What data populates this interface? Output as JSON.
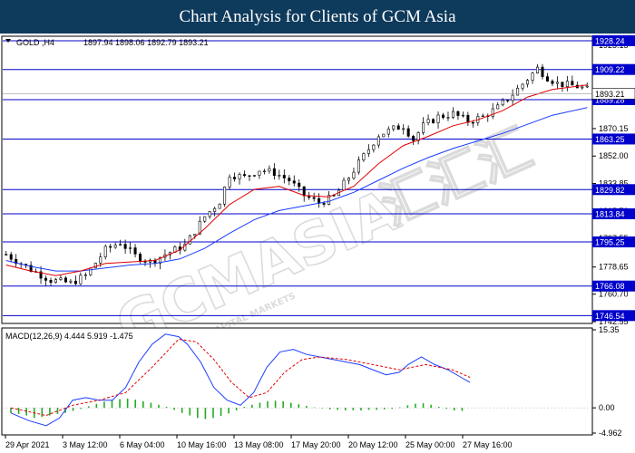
{
  "header": {
    "title": "Chart Analysis for Clients of GCM Asia"
  },
  "watermark": {
    "brand": "GCMASIA",
    "chinese": "汇汇汇",
    "sub": "GLOBAL CAPITAL MARKETS"
  },
  "chart_data": [
    {
      "type": "candlestick",
      "symbol_label": "GOLD ,H4",
      "ohlc_text": "1897.94 1898.06 1892.79 1893.21",
      "ylim": [
        1742.55,
        1930
      ],
      "y_ticks": [
        1925.15,
        1907.7,
        1889.25,
        1870.15,
        1852.0,
        1833.85,
        1815.7,
        1797.55,
        1778.65,
        1760.7,
        1742.55
      ],
      "y_tick_labels": [
        "1925.15",
        "1907.70",
        "1889.25",
        "1870.15",
        "1852.00",
        "1833.85",
        "1815.70",
        "1797.55",
        "1778.65",
        "1760.70",
        "1742.55"
      ],
      "current_price": 1893.21,
      "current_price_label": "1893.21",
      "levels": [
        {
          "value": 1928.24,
          "label": "1928.24"
        },
        {
          "value": 1909.22,
          "label": "1909.22"
        },
        {
          "value": 1889.28,
          "label": "1889.28"
        },
        {
          "value": 1863.25,
          "label": "1863.25"
        },
        {
          "value": 1829.82,
          "label": "1829.82"
        },
        {
          "value": 1813.84,
          "label": "1813.84"
        },
        {
          "value": 1795.25,
          "label": "1795.25"
        },
        {
          "value": 1766.08,
          "label": "1766.08"
        },
        {
          "value": 1746.54,
          "label": "1746.54"
        }
      ],
      "close_path": [
        [
          0,
          1787
        ],
        [
          5,
          1777
        ],
        [
          9,
          1770
        ],
        [
          13,
          1768
        ],
        [
          16,
          1773
        ],
        [
          20,
          1790
        ],
        [
          23,
          1795
        ],
        [
          26,
          1786
        ],
        [
          29,
          1782
        ],
        [
          32,
          1787
        ],
        [
          36,
          1793
        ],
        [
          40,
          1812
        ],
        [
          43,
          1822
        ],
        [
          45,
          1840
        ],
        [
          48,
          1838
        ],
        [
          51,
          1843
        ],
        [
          54,
          1841
        ],
        [
          57,
          1836
        ],
        [
          60,
          1826
        ],
        [
          63,
          1821
        ],
        [
          66,
          1825
        ],
        [
          69,
          1838
        ],
        [
          72,
          1852
        ],
        [
          75,
          1866
        ],
        [
          78,
          1870
        ],
        [
          80,
          1872
        ],
        [
          82,
          1863
        ],
        [
          84,
          1872
        ],
        [
          87,
          1878
        ],
        [
          90,
          1880
        ],
        [
          93,
          1875
        ],
        [
          96,
          1878
        ],
        [
          99,
          1884
        ],
        [
          102,
          1893
        ],
        [
          105,
          1903
        ],
        [
          107,
          1910
        ],
        [
          109,
          1904
        ],
        [
          111,
          1900
        ],
        [
          113,
          1899
        ],
        [
          115,
          1898
        ],
        [
          117,
          1896
        ]
      ],
      "ma_fast": [
        [
          0,
          1780
        ],
        [
          5,
          1776
        ],
        [
          10,
          1773
        ],
        [
          15,
          1776
        ],
        [
          20,
          1781
        ],
        [
          25,
          1782
        ],
        [
          30,
          1783
        ],
        [
          35,
          1790
        ],
        [
          40,
          1804
        ],
        [
          45,
          1820
        ],
        [
          50,
          1830
        ],
        [
          55,
          1832
        ],
        [
          60,
          1826
        ],
        [
          65,
          1825
        ],
        [
          70,
          1832
        ],
        [
          75,
          1847
        ],
        [
          80,
          1859
        ],
        [
          85,
          1865
        ],
        [
          90,
          1872
        ],
        [
          95,
          1876
        ],
        [
          100,
          1882
        ],
        [
          105,
          1891
        ],
        [
          110,
          1896
        ],
        [
          117,
          1899
        ]
      ],
      "ma_slow": [
        [
          0,
          1783
        ],
        [
          5,
          1779
        ],
        [
          10,
          1776
        ],
        [
          15,
          1776
        ],
        [
          20,
          1778
        ],
        [
          25,
          1780
        ],
        [
          30,
          1781
        ],
        [
          35,
          1784
        ],
        [
          40,
          1791
        ],
        [
          45,
          1801
        ],
        [
          50,
          1810
        ],
        [
          55,
          1816
        ],
        [
          60,
          1819
        ],
        [
          65,
          1822
        ],
        [
          70,
          1828
        ],
        [
          75,
          1836
        ],
        [
          80,
          1844
        ],
        [
          85,
          1851
        ],
        [
          90,
          1857
        ],
        [
          95,
          1862
        ],
        [
          100,
          1867
        ],
        [
          105,
          1873
        ],
        [
          110,
          1879
        ],
        [
          117,
          1884
        ]
      ],
      "x_tick_labels": [
        {
          "i": 0,
          "label": "29 Apr 2021"
        },
        {
          "i": 12,
          "label": "3 May 12:00"
        },
        {
          "i": 24,
          "label": "6 May 04:00"
        },
        {
          "i": 36,
          "label": "10 May 16:00"
        },
        {
          "i": 48,
          "label": "13 May 08:00"
        },
        {
          "i": 60,
          "label": "17 May 20:00"
        },
        {
          "i": 72,
          "label": "20 May 12:00"
        },
        {
          "i": 84,
          "label": "25 May 00:00"
        },
        {
          "i": 96,
          "label": "27 May 16:00"
        }
      ],
      "colors": {
        "level": "#0000cc",
        "ma_fast": "#e00000",
        "ma_slow": "#1a3cff",
        "candle": "#000000"
      }
    },
    {
      "type": "macd",
      "label": "MACD(12,26,9) 4.444 5.919 -1.475",
      "ylim": [
        -4.962,
        15.35
      ],
      "y_tick_labels": [
        {
          "value": 15.35,
          "label": "15.35"
        },
        {
          "value": 0.0,
          "label": "0.00"
        },
        {
          "value": -4.962,
          "label": "-4.962"
        }
      ],
      "macd": [
        [
          0,
          -1
        ],
        [
          4,
          -2.5
        ],
        [
          8,
          -3.5
        ],
        [
          11,
          -2
        ],
        [
          14,
          1.5
        ],
        [
          17,
          2
        ],
        [
          20,
          1.5
        ],
        [
          23,
          1.5
        ],
        [
          26,
          4
        ],
        [
          29,
          9
        ],
        [
          32,
          12.5
        ],
        [
          35,
          14.5
        ],
        [
          38,
          14
        ],
        [
          40,
          12.5
        ],
        [
          43,
          9
        ],
        [
          46,
          4
        ],
        [
          49,
          1.5
        ],
        [
          52,
          0.5
        ],
        [
          55,
          3
        ],
        [
          58,
          8
        ],
        [
          61,
          11
        ],
        [
          64,
          11.5
        ],
        [
          67,
          10.5
        ],
        [
          70,
          10
        ],
        [
          73,
          9.5
        ],
        [
          76,
          9
        ],
        [
          79,
          8.5
        ],
        [
          82,
          7.5
        ],
        [
          85,
          6.5
        ],
        [
          88,
          7
        ],
        [
          90,
          8.5
        ],
        [
          93,
          10
        ],
        [
          96,
          8.5
        ],
        [
          99,
          7.5
        ],
        [
          102,
          6
        ],
        [
          104,
          5
        ]
      ],
      "signal": [
        [
          0,
          0
        ],
        [
          8,
          -1.5
        ],
        [
          14,
          0.5
        ],
        [
          20,
          1.5
        ],
        [
          26,
          3
        ],
        [
          32,
          8
        ],
        [
          38,
          13.5
        ],
        [
          42,
          13
        ],
        [
          46,
          9.5
        ],
        [
          50,
          5
        ],
        [
          54,
          2
        ],
        [
          58,
          3
        ],
        [
          62,
          7
        ],
        [
          66,
          9.5
        ],
        [
          70,
          10
        ],
        [
          76,
          9.5
        ],
        [
          82,
          8.5
        ],
        [
          88,
          7.5
        ],
        [
          94,
          8.5
        ],
        [
          100,
          7.5
        ],
        [
          104,
          6
        ]
      ],
      "histogram": [
        -1,
        -1.2,
        -1.5,
        -2,
        -1.8,
        -1.5,
        -1.2,
        -1,
        -0.6,
        -0.2,
        0.3,
        0.8,
        1.2,
        1.5,
        1.7,
        1.8,
        1.6,
        1.3,
        1.0,
        0.6,
        0.2,
        -0.4,
        -1,
        -1.5,
        -2,
        -2.2,
        -2,
        -1.6,
        -1.1,
        -0.5,
        0.2,
        0.6,
        1.0,
        1.3,
        1.4,
        1.3,
        1.0,
        0.7,
        0.4,
        0.1,
        -0.1,
        -0.3,
        -0.4,
        -0.5,
        -0.5,
        -0.5,
        -0.4,
        -0.4,
        -0.3,
        -0.2,
        0.1,
        0.5,
        0.8,
        0.9,
        0.6,
        0.2,
        -0.2,
        -0.5,
        -0.6
      ],
      "colors": {
        "macd": "#1a3cff",
        "signal": "#e00000",
        "histogram": "#22aa22"
      }
    }
  ]
}
